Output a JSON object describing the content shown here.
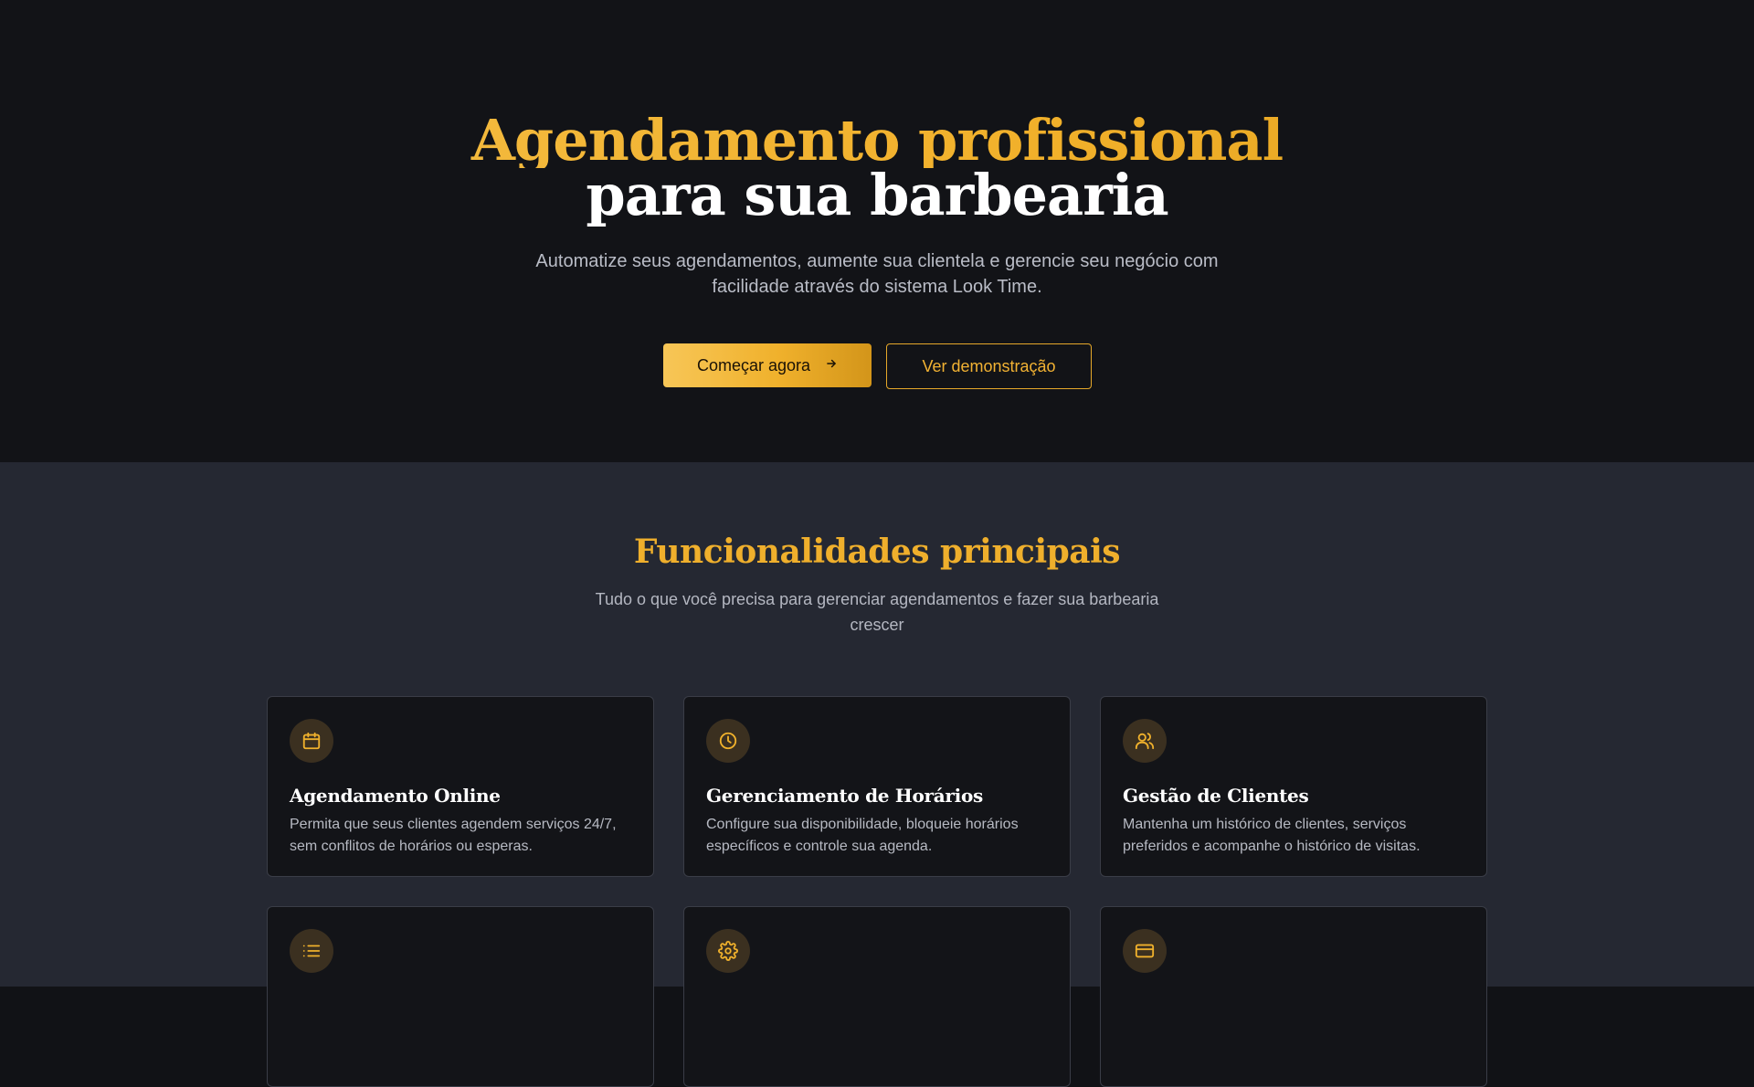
{
  "hero": {
    "title_line1": "Agendamento profissional",
    "title_line2": "para sua barbearia",
    "subtitle": "Automatize seus agendamentos, aumente sua clientela e gerencie seu negócio com facilidade através do sistema Look Time.",
    "primary_button": "Começar agora",
    "primary_button_icon": "arrow-right-icon",
    "secondary_button": "Ver demonstração"
  },
  "features": {
    "title": "Funcionalidades principais",
    "subtitle": "Tudo o que você precisa para gerenciar agendamentos e fazer sua barbearia crescer",
    "cards": [
      {
        "icon": "calendar-icon",
        "title": "Agendamento Online",
        "description": "Permita que seus clientes agendem serviços 24/7, sem conflitos de horários ou esperas."
      },
      {
        "icon": "clock-icon",
        "title": "Gerenciamento de Horários",
        "description": "Configure sua disponibilidade, bloqueie horários específicos e controle sua agenda."
      },
      {
        "icon": "users-icon",
        "title": "Gestão de Clientes",
        "description": "Mantenha um histórico de clientes, serviços preferidos e acompanhe o histórico de visitas."
      },
      {
        "icon": "list-icon",
        "title": "",
        "description": ""
      },
      {
        "icon": "gear-icon",
        "title": "",
        "description": ""
      },
      {
        "icon": "credit-card-icon",
        "title": "",
        "description": ""
      }
    ]
  },
  "colors": {
    "accent": "#f0b12c",
    "hero_background": "#121317",
    "features_background": "#252832",
    "card_background": "#131418"
  }
}
